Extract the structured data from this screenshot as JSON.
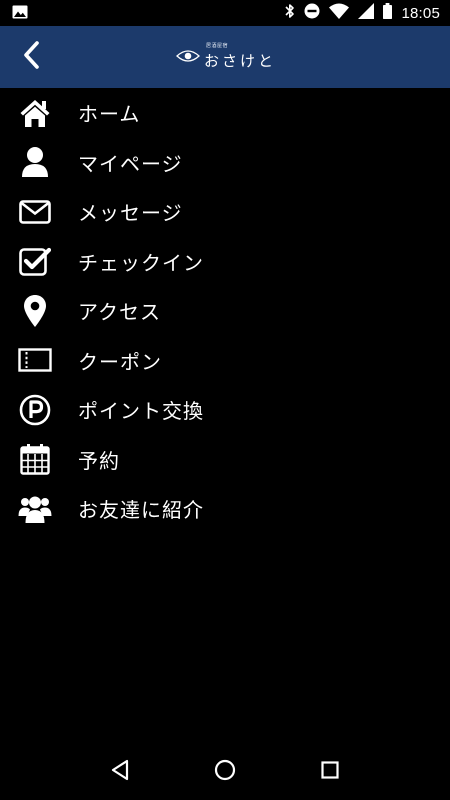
{
  "status_bar": {
    "time": "18:05",
    "icons": [
      "image-icon",
      "bluetooth-icon",
      "do-not-disturb-icon",
      "wifi-icon",
      "signal-icon",
      "battery-icon"
    ]
  },
  "header": {
    "back_icon": "chevron-left-icon",
    "logo_small": "居酒屋宿",
    "logo_main": "おさけと",
    "colors": {
      "background": "#1c3a6b",
      "foreground": "#ffffff"
    }
  },
  "menu": {
    "items": [
      {
        "label": "ホーム",
        "icon": "home-icon"
      },
      {
        "label": "マイページ",
        "icon": "user-icon"
      },
      {
        "label": "メッセージ",
        "icon": "envelope-icon"
      },
      {
        "label": "チェックイン",
        "icon": "checkbox-icon"
      },
      {
        "label": "アクセス",
        "icon": "map-pin-icon"
      },
      {
        "label": "クーポン",
        "icon": "coupon-icon"
      },
      {
        "label": "ポイント交換",
        "icon": "parking-circle-icon"
      },
      {
        "label": "予約",
        "icon": "calendar-icon"
      },
      {
        "label": "お友達に紹介",
        "icon": "users-icon"
      }
    ]
  },
  "nav_bar": {
    "icons": [
      "back-triangle-icon",
      "home-circle-icon",
      "recents-square-icon"
    ]
  },
  "colors": {
    "page_background": "#000000",
    "text": "#ffffff",
    "header": "#1c3a6b"
  }
}
